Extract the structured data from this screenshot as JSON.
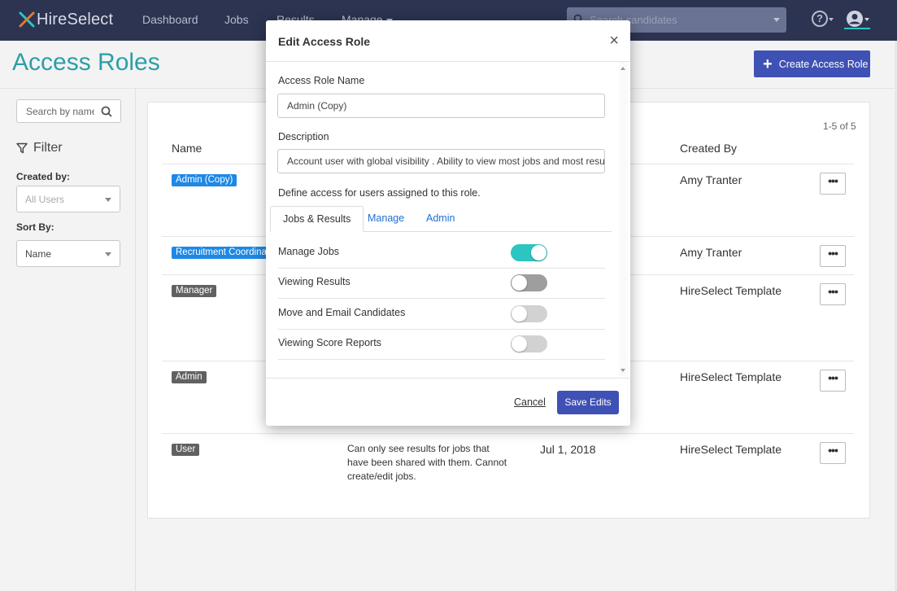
{
  "nav": {
    "logo_text": "HireSelect",
    "items": [
      "Dashboard",
      "Jobs",
      "Results",
      "Manage"
    ],
    "search_placeholder": "Search candidates"
  },
  "page": {
    "title": "Access Roles",
    "create_button": "Create Access Role"
  },
  "sidebar": {
    "search_placeholder": "Search by name",
    "filter_title": "Filter",
    "created_by_label": "Created by:",
    "created_by_value": "All Users",
    "sort_by_label": "Sort By:",
    "sort_by_value": "Name"
  },
  "table": {
    "count": "1-5 of 5",
    "headers": {
      "name": "Name",
      "created_by": "Created By"
    },
    "rows": [
      {
        "name": "Admin (Copy)",
        "badge_color": "#1e88e5",
        "description": "",
        "date": "",
        "created_by": "Amy Tranter"
      },
      {
        "name": "Recruitment Coordinator",
        "badge_color": "#1e88e5",
        "description": "",
        "date": "",
        "created_by": "Amy Tranter"
      },
      {
        "name": "Manager",
        "badge_color": "#616161",
        "description": "",
        "date": "",
        "created_by": "HireSelect Template"
      },
      {
        "name": "Admin",
        "badge_color": "#616161",
        "description": "",
        "date": "",
        "created_by": "HireSelect Template"
      },
      {
        "name": "User",
        "badge_color": "#616161",
        "description": "Can only see results for jobs that have been shared with them. Cannot create/edit jobs.",
        "date": "Jul 1, 2018",
        "created_by": "HireSelect Template"
      }
    ],
    "row_action": "•••"
  },
  "modal": {
    "title": "Edit Access Role",
    "close": "×",
    "role_name_label": "Access Role Name",
    "role_name_value": "Admin (Copy)",
    "description_label": "Description",
    "description_value": "Account user with global visibility . Ability to view most jobs and most results",
    "define_access_text": "Define access for users assigned to this role.",
    "tabs": [
      "Jobs & Results",
      "Manage",
      "Admin"
    ],
    "active_tab": "Jobs & Results",
    "permissions": [
      {
        "label": "Manage Jobs",
        "enabled": true
      },
      {
        "label": "Viewing Results",
        "enabled": false
      },
      {
        "label": "Move and Email Candidates",
        "enabled": false
      },
      {
        "label": "Viewing Score Reports",
        "enabled": false
      }
    ],
    "cancel_label": "Cancel",
    "save_label": "Save Edits"
  },
  "colors": {
    "navbar": "#2c3452",
    "accent_teal": "#2b9fa6",
    "primary": "#3f51b5",
    "toggle_on": "#2cc5c0"
  }
}
